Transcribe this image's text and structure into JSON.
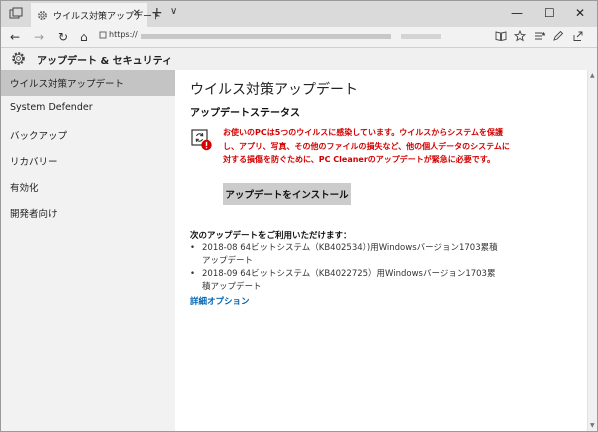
{
  "browser": {
    "tab_title": "ウイルス対策アップデート",
    "tab_close": "✕",
    "new_tab": "+",
    "tab_list": "∨",
    "minimize": "—",
    "maximize": "☐",
    "close": "✕",
    "back": "←",
    "forward": "→",
    "refresh": "↻",
    "home": "⌂",
    "url_prefix": "https://"
  },
  "settings": {
    "header_title": "アップデート & セキュリティ"
  },
  "sidebar": {
    "items": [
      {
        "label": "ウイルス対策アップデート",
        "active": true
      },
      {
        "label": "System Defender"
      },
      {
        "label": "バックアップ"
      },
      {
        "label": "リカバリー"
      },
      {
        "label": "有効化"
      },
      {
        "label": "開発者向け"
      }
    ]
  },
  "main": {
    "page_title": "ウイルス対策アップデート",
    "section_title": "アップデートステータス",
    "warning_text": "お使いのPCは5つのウイルスに感染しています。ウイルスからシステムを保護し、アプリ、写真、その他のファイルの損失など、他の個人データのシステムに対する損傷を防ぐために、PC Cleanerのアップデートが緊急に必要です。",
    "install_button": "アップデートをインストール",
    "available_title": "次のアップデートをご利用いただけます：",
    "updates": [
      {
        "bullet": "•",
        "text": "2018-08 64ビットシステム（KB402534）)用Windowsバージョン1703累積アップデート"
      },
      {
        "bullet": "•",
        "text": "2018-09 64ビットシステム（KB4022725）用Windowsバージョン1703累積アップデート"
      }
    ],
    "advanced_link": "詳細オプション"
  },
  "colors": {
    "warning": "#d40000",
    "link": "#0063b1",
    "active_item": "#c4c4c4"
  },
  "icons": {
    "tab_favicon": "gear-icon",
    "settings_header": "gear-icon",
    "update_status": "sync-warning-icon"
  }
}
